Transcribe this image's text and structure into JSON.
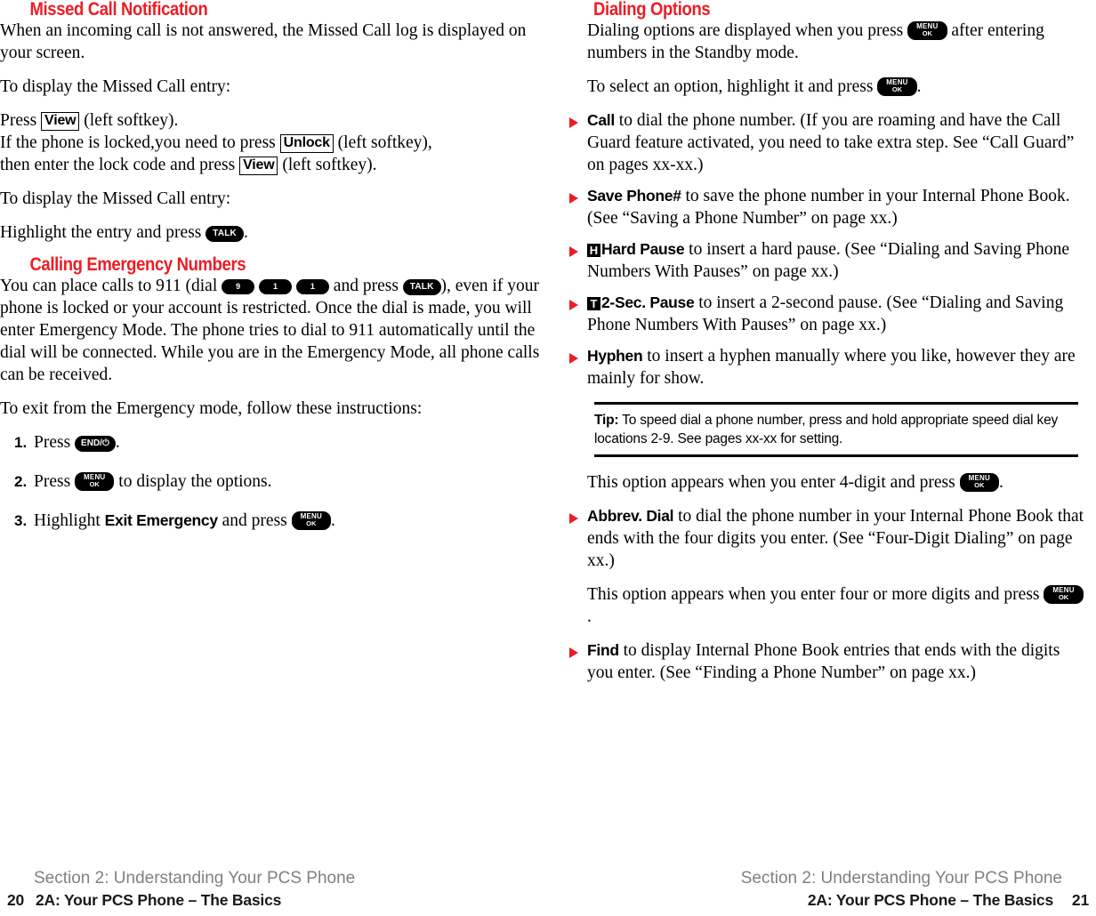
{
  "document": {
    "type": "phone-user-manual-spread",
    "accent_color": "#ed1c24",
    "body_color": "#000000",
    "footer_section_color": "#808080"
  },
  "left_page": {
    "heading_missed_call": "Missed Call Notification",
    "intro": "When an incoming call is not answered, the Missed Call log is displayed on your screen.",
    "lead_1": "To display the Missed Call entry:",
    "bullet_1": {
      "line1_pre": "Press",
      "softkey_view": "View",
      "line1_post": "(left softkey).",
      "line2_pre": "If the phone is locked,you need to press",
      "softkey_unlock": "Unlock",
      "line2_mid": "(left softkey),",
      "line3_pre": "then enter the lock code and press",
      "softkey_view2": "View",
      "line3_post": "(left softkey)."
    },
    "lead_2": "To display the Missed Call entry:",
    "bullet_2": {
      "pre": "Highlight the entry and press",
      "key_talk": "TALK",
      "post": "."
    },
    "heading_emergency": "Calling Emergency Numbers",
    "emergency_para": {
      "pre": "You can place calls to 911 (dial",
      "key_9": "9",
      "key_1a": "1",
      "key_1b": "1",
      "mid": "and press",
      "key_talk": "TALK",
      "post": "), even if your phone is locked or your account is restricted. Once the dial is made, you will enter Emergency Mode. The phone tries to dial to 911 automatically until the dial will be connected. While you are in the Emergency Mode, all phone calls can be received."
    },
    "exit_lead": "To exit from the Emergency mode, follow these instructions:",
    "steps": [
      {
        "number": "1.",
        "pre": "Press",
        "key_label": "END/⏻",
        "key_type": "end",
        "post": "."
      },
      {
        "number": "2.",
        "pre": "Press",
        "key_label_line1": "MENU",
        "key_label_line2": "OK",
        "key_type": "menu",
        "post": "to display the options."
      },
      {
        "number": "3.",
        "pre": "Highlight",
        "bold_option": "Exit Emergency",
        "mid": "and press",
        "key_label_line1": "MENU",
        "key_label_line2": "OK",
        "key_type": "menu",
        "post": "."
      }
    ]
  },
  "right_page": {
    "heading_dialing": "Dialing Options",
    "intro_pre": "Dialing options are displayed when you press",
    "intro_key_l1": "MENU",
    "intro_key_l2": "OK",
    "intro_post": "after entering numbers in the Standby mode.",
    "select_pre": "To select an option, highlight it and press",
    "select_key_l1": "MENU",
    "select_key_l2": "OK",
    "select_post": ".",
    "options": [
      {
        "glyph": "",
        "label": "Call",
        "text": "to dial the phone number. (If you are roaming and have the Call Guard feature activated, you need to take extra step. See “Call Guard” on pages xx-xx.)"
      },
      {
        "glyph": "",
        "label": "Save Phone#",
        "text": "to save the phone number in your Internal Phone Book. (See “Saving a Phone Number” on page xx.)"
      },
      {
        "glyph": "H",
        "label": "Hard Pause",
        "text": "to insert a hard pause. (See “Dialing and Saving Phone Numbers With Pauses” on page xx.)"
      },
      {
        "glyph": "T",
        "label": "2-Sec. Pause",
        "text": "to insert a 2-second pause. (See “Dialing and Saving Phone Numbers With Pauses” on page xx.)"
      },
      {
        "glyph": "",
        "label": "Hyphen",
        "text": "to insert a hyphen manually where you like, however they are mainly for show."
      }
    ],
    "tip": {
      "label": "Tip:",
      "text": "To speed dial a phone number, press and hold appropriate speed dial key locations 2-9. See pages xx-xx for setting."
    },
    "four_digit_lead_pre": "This option appears when you enter 4-digit and press",
    "four_digit_key_l1": "MENU",
    "four_digit_key_l2": "OK",
    "four_digit_lead_post": ".",
    "abbrev_option": {
      "label": "Abbrev. Dial",
      "text": "to dial the phone number in your Internal Phone Book that ends with the four digits you enter. (See “Four-Digit Dialing” on page xx.)"
    },
    "find_lead_pre": "This option appears when you enter four or more digits and press",
    "find_key_l1": "MENU",
    "find_key_l2": "OK",
    "find_lead_post": ".",
    "find_option": {
      "label": "Find",
      "text": "to display Internal Phone Book entries that ends with the digits you enter. (See “Finding a Phone Number” on page xx.)"
    }
  },
  "footer_left": {
    "section": "Section 2: Understanding Your PCS Phone",
    "page_number": "20",
    "chapter": "2A: Your PCS Phone – The Basics"
  },
  "footer_right": {
    "section": "Section 2: Understanding Your PCS Phone",
    "page_number": "21",
    "chapter": "2A: Your PCS Phone – The Basics"
  }
}
